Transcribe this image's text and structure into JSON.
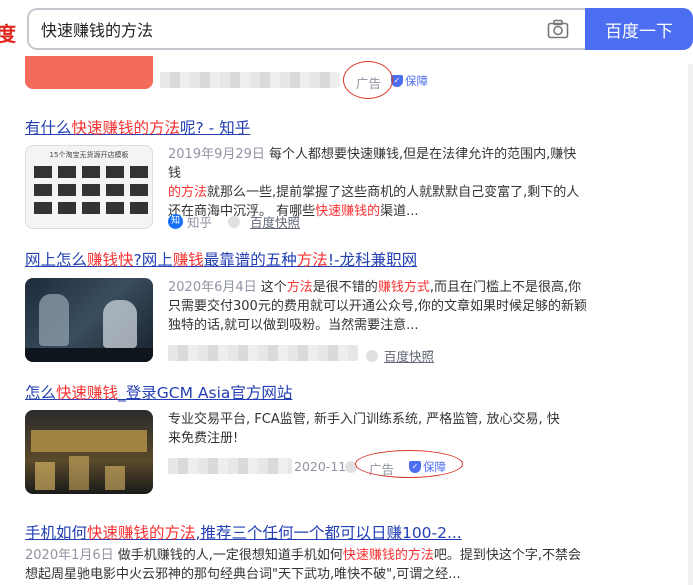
{
  "search": {
    "logo_fragment": "度",
    "query": "快速赚钱的方法",
    "button": "百度一下"
  },
  "top_ad": {
    "ad_label": "广告",
    "bao_label": "保障"
  },
  "r1": {
    "title_a": "有什么",
    "title_hl": "快速赚钱的方法",
    "title_b": "呢? - 知乎",
    "thumb_text": "15个淘宝无货源开店模板",
    "date": "2019年9月29日",
    "s1": " 每个人都想要快速赚钱,但是在法律允许的范围内,赚快钱",
    "s2_hl": "的方法",
    "s2": "就那么一些,提前掌握了这些商机的人就默默自己变富了,剩下的人",
    "s3a": "还在商海中沉浮。 有哪些",
    "s3_hl": "快速赚钱的",
    "s3b": "渠道...",
    "source_icon": "知",
    "source": "知乎",
    "kuaizhao": "百度快照"
  },
  "r2": {
    "title_a": "网上怎么",
    "title_hl1": "赚钱快",
    "title_b": "?网上",
    "title_hl2": "赚钱",
    "title_c": "最靠谱的五种",
    "title_hl3": "方法",
    "title_d": "!-龙科兼职网",
    "date": "2020年6月4日",
    "s1a": " 这个",
    "s1_hl": "方法",
    "s1b": "是很不错的",
    "s1_hl2": "赚钱方式",
    "s1c": ",而且在门槛上不是很高,你",
    "s2": "只需要交付300元的费用就可以开通公众号,你的文章如果时候足够的新颖",
    "s3": "独特的话,就可以做到吸粉。当然需要注意...",
    "kuaizhao": "百度快照"
  },
  "r3": {
    "title_a": "怎么",
    "title_hl": "快速赚钱",
    "title_b": "_登录GCM Asia官方网站",
    "s1": "专业交易平台, FCA监管, 新手入门训练系统, 严格监管, 放心交易, 快",
    "s2": "来免费注册!",
    "date": "2020-11",
    "ad_label": "广告",
    "bao_label": "保障"
  },
  "r4": {
    "title_a": "手机如何",
    "title_hl": "快速赚钱的方法",
    "title_b": ",推荐三个任何一个都可以日赚100-2...",
    "date": "2020年1月6日",
    "s1a": " 做手机赚钱的人,一定很想知道手机如何",
    "s1_hl": "快速赚钱的方法",
    "s1b": "吧。提到快这个字,不禁会",
    "s2": "想起周星驰电影中火云邪神的那句经典台词\"天下武功,唯快不破\",可谓之经..."
  },
  "colors": {
    "brand_blue": "#4e6ef2",
    "link": "#2440b3",
    "highlight": "#f73131",
    "annotation": "#d9352b"
  }
}
